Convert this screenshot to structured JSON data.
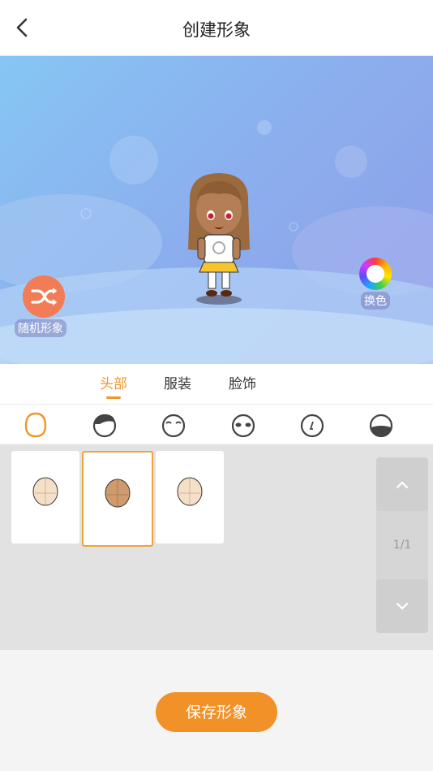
{
  "header": {
    "title": "创建形象"
  },
  "stage": {
    "random_label": "随机形象",
    "color_label": "换色"
  },
  "tabs": [
    {
      "label": "头部",
      "active": true
    },
    {
      "label": "服装",
      "active": false
    },
    {
      "label": "脸饰",
      "active": false
    }
  ],
  "categories": [
    "face-shape-icon",
    "hair-icon",
    "eyebrows-icon",
    "eyes-icon",
    "nose-icon",
    "mouth-icon"
  ],
  "face_options": [
    {
      "skin": "#f6dfc7",
      "selected": false
    },
    {
      "skin": "#cf9a6d",
      "selected": true
    },
    {
      "skin": "#f6dfc7",
      "selected": false
    }
  ],
  "pager": {
    "page": "1/1"
  },
  "actions": {
    "save_label": "保存形象"
  },
  "colors": {
    "accent": "#f0962a",
    "random_bg": "#f27c55"
  }
}
